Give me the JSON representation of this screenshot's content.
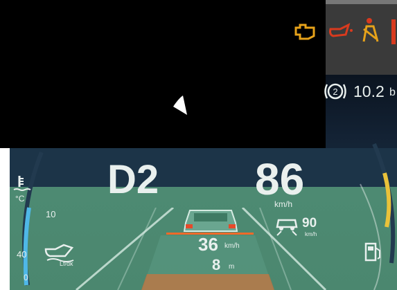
{
  "gear": "D2",
  "speed": {
    "value": "86",
    "unit": "km/h"
  },
  "acc": {
    "set_speed": "36",
    "set_unit": "km/h",
    "distance_value": "8",
    "distance_unit": "m"
  },
  "speed_limit": {
    "value": "90",
    "unit": "km/h"
  },
  "range": {
    "value": "10.2",
    "partial_unit": "b"
  },
  "parking_icon_label": "2",
  "temperature": {
    "unit": "°C",
    "mark_high": "10",
    "mark_low": "40",
    "mark_bottom": "0"
  },
  "oil": {
    "label": "Lf/dk"
  },
  "colors": {
    "gear_text": "#e9f0ee",
    "warning_amber": "#e6a21a",
    "warning_red": "#d83a1e",
    "cyan_gauge": "#4fb8e8",
    "yellow_gauge": "#e9c23a",
    "dashboard_green": "#4f8a73",
    "lane_orange": "#f06a2a"
  },
  "icons": {
    "top_warnings": [
      "engine-warning-icon",
      "oil-pressure-icon",
      "seatbelt-warning-icon",
      "airbag-warning-icon"
    ],
    "left_side": [
      "coolant-temperature-icon",
      "oil-level-icon"
    ],
    "right_side": [
      "fuel-pump-icon"
    ],
    "adas": [
      "lane-assist-icon",
      "car-ahead-icon"
    ]
  }
}
